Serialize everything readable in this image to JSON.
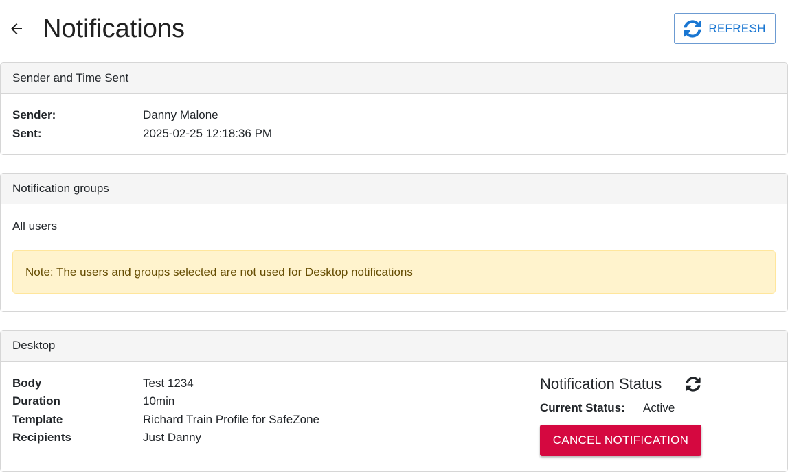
{
  "header": {
    "title": "Notifications",
    "refresh_label": "REFRESH"
  },
  "sender_card": {
    "title": "Sender and Time Sent",
    "rows": [
      {
        "key": "Sender:",
        "value": "Danny Malone"
      },
      {
        "key": "Sent:",
        "value": "2025-02-25 12:18:36 PM"
      }
    ]
  },
  "groups_card": {
    "title": "Notification groups",
    "groups_text": "All users",
    "note": "Note: The users and groups selected are not used for Desktop notifications"
  },
  "desktop_card": {
    "title": "Desktop",
    "rows": [
      {
        "key": "Body",
        "value": "Test 1234"
      },
      {
        "key": "Duration",
        "value": "10min"
      },
      {
        "key": "Template",
        "value": "Richard Train Profile for SafeZone"
      },
      {
        "key": "Recipients",
        "value": "Just Danny"
      }
    ],
    "status_title": "Notification Status",
    "current_status_label": "Current Status:",
    "current_status_value": "Active",
    "cancel_label": "CANCEL NOTIFICATION"
  },
  "colors": {
    "accent": "#1976d2",
    "danger": "#d50840",
    "note_bg": "#fff3cd",
    "note_text": "#664d03"
  },
  "icons": {
    "back": "arrow-left-icon",
    "refresh": "refresh-icon",
    "status_refresh": "sync-icon"
  }
}
